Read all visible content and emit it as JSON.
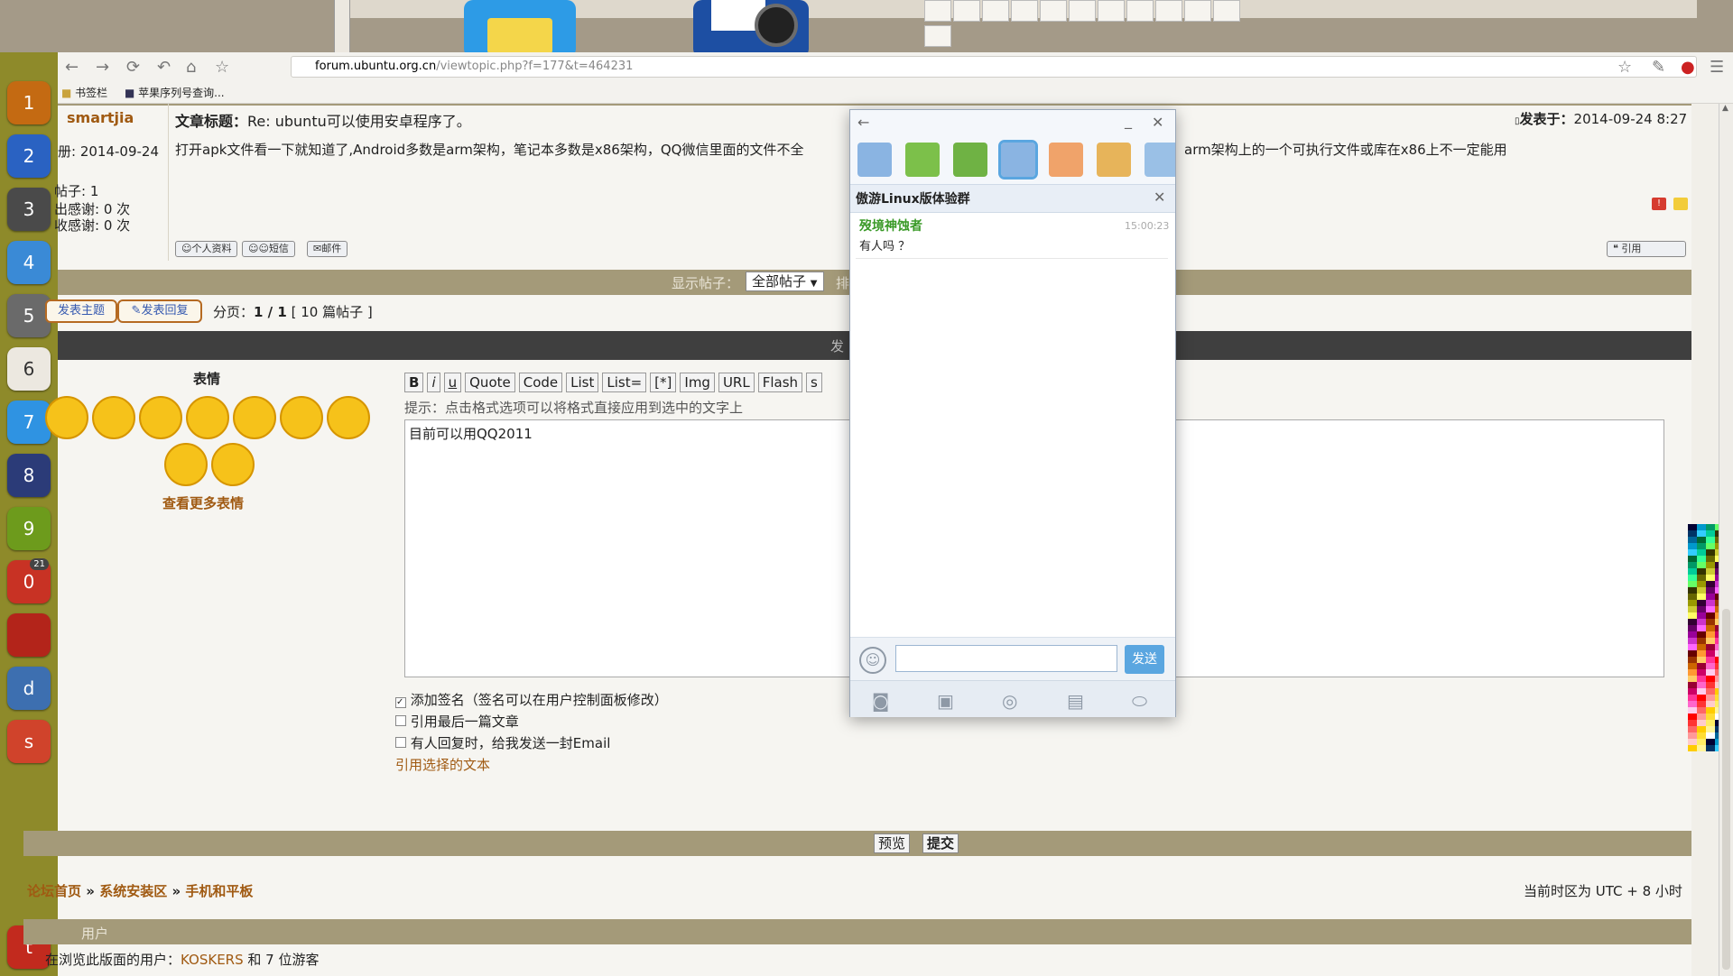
{
  "colors": {
    "accent_bar": "#a49a79",
    "link": "#a05a12",
    "qq_send": "#5aa6e0",
    "launcher": "#8e8a2a"
  },
  "browser": {
    "url_domain": "forum.ubuntu.org.cn",
    "url_path": "/viewtopic.php?f=177&t=464231",
    "bookmarks": [
      {
        "label": "书签栏",
        "icon": "folder-icon"
      },
      {
        "label": "苹果序列号查询...",
        "icon": "apple-icon"
      }
    ]
  },
  "launcher": {
    "items": [
      {
        "label": "1",
        "color": "#c46a12"
      },
      {
        "label": "2",
        "color": "#2a62c2"
      },
      {
        "label": "3",
        "color": "#4a4a4a"
      },
      {
        "label": "4",
        "color": "#3a8ad6"
      },
      {
        "label": "5",
        "color": "#6a6a6a"
      },
      {
        "label": "6",
        "color": "#ece8e0"
      },
      {
        "label": "7",
        "color": "#2f93e2"
      },
      {
        "label": "8",
        "color": "#2b3b78"
      },
      {
        "label": "9",
        "color": "#6d9b1c"
      },
      {
        "label": "0",
        "color": "#c83224",
        "badge": "21"
      },
      {
        "label": "",
        "color": "#b3241a"
      },
      {
        "label": "d",
        "color": "#3d6fb0"
      },
      {
        "label": "s",
        "color": "#d0432b"
      },
      {
        "label": "t",
        "color": "#c22a1e"
      }
    ]
  },
  "post": {
    "author": "smartjia",
    "title_label": "文章标题：",
    "title": "Re: ubuntu可以使用安卓程序了。",
    "posted_label": "发表于：",
    "posted_at": "2014-09-24 8:27",
    "join_fragment": "册: 2014-09-24",
    "posts_fragment": "帖子: 1",
    "thanks_given": "出感谢: 0 次",
    "thanks_received": "收感谢: 0 次",
    "body_left": "打开apk文件看一下就知道了,Android多数是arm架构，笔记本多数是x86架构，QQ微信里面的文件不全",
    "body_right": "arm架构上的一个可执行文件或库在x86上不一定能用",
    "profile_btn": "个人资料",
    "pm_btn": "短信",
    "email_btn": "邮件",
    "quote_btn": "引用"
  },
  "display_bar": {
    "label": "显示帖子：",
    "select_value": "全部帖子",
    "trailing": "排"
  },
  "actions": {
    "new_topic": "发表主题",
    "reply": "发表回复",
    "page_label": "分页：",
    "page_value": "1 / 1",
    "count": "[ 10 篇帖子 ]"
  },
  "editor_bar_fragment": "发",
  "smilies": {
    "heading": "表情",
    "more": "查看更多表情"
  },
  "format_buttons": [
    "B",
    "i",
    "u",
    "Quote",
    "Code",
    "List",
    "List=",
    "[*]",
    "Img",
    "URL",
    "Flash",
    "s"
  ],
  "editor": {
    "hint": "提示：点击格式选项可以将格式直接应用到选中的文字上",
    "text": "目前可以用QQ2011"
  },
  "options": [
    {
      "label": "添加签名（签名可以在用户控制面板修改）",
      "checked": true
    },
    {
      "label": "引用最后一篇文章",
      "checked": false
    },
    {
      "label": "有人回复时，给我发送一封Email",
      "checked": false
    }
  ],
  "quote_selected": "引用选择的文本",
  "submit": {
    "preview": "预览",
    "submit": "提交"
  },
  "breadcrumb": {
    "home": "论坛首页",
    "sep": "»",
    "section": "系统安装区",
    "forum": "手机和平板"
  },
  "timezone": "当前时区为 UTC + 8 小时",
  "users": {
    "header_fragment": "用户",
    "viewing_prefix": "在浏览此版面的用户：",
    "user": "KOSKERS",
    "suffix": "和 7 位游客"
  },
  "qq": {
    "group_name": "傲游Linux版体验群",
    "message": {
      "sender": "歿境神蚀者",
      "time": "15:00:23",
      "text": "有人吗 ？"
    },
    "send_button": "发送",
    "input_value": "",
    "avatars": [
      {
        "icon": "user-group-icon",
        "color": "#8ab4e2"
      },
      {
        "icon": "chat-group-icon",
        "color": "#7cc04a"
      },
      {
        "icon": "chat-group-icon",
        "color": "#6fb244"
      },
      {
        "icon": "user-group-icon",
        "color": "#8ab4e2",
        "selected": true
      },
      {
        "icon": "user-group-icon",
        "color": "#f0a36a"
      },
      {
        "icon": "user-group-icon",
        "color": "#e7b45a"
      },
      {
        "icon": "user-group-icon",
        "color": "#9ac0e6"
      }
    ]
  }
}
